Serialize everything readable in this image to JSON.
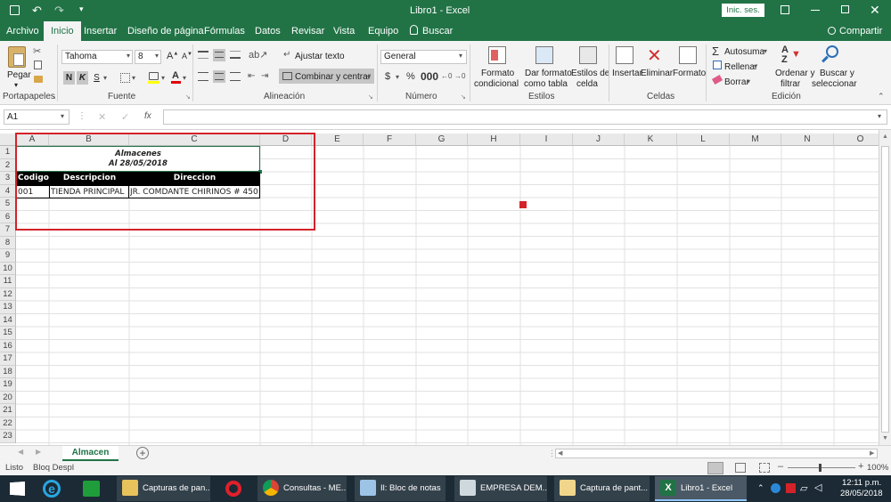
{
  "app": {
    "title": "Libro1 - Excel",
    "signin_label": "Inic. ses.",
    "accent": "#217346"
  },
  "ribbon_tabs": [
    "Archivo",
    "Inicio",
    "Insertar",
    "Diseño de página",
    "Fórmulas",
    "Datos",
    "Revisar",
    "Vista",
    "Equipo"
  ],
  "search_label": "Buscar",
  "share_label": "Compartir",
  "ribbon": {
    "paste_label": "Pegar",
    "font_name": "Tahoma",
    "font_size": "8",
    "bold": "N",
    "italic": "K",
    "underline": "S",
    "wrap_text": "Ajustar texto",
    "merge_center": "Combinar y centrar",
    "number_format": "General",
    "cond_format_1": "Formato",
    "cond_format_2": "condicional",
    "format_table_1": "Dar formato",
    "format_table_2": "como tabla",
    "cell_styles_1": "Estilos de",
    "cell_styles_2": "celda",
    "insert": "Insertar",
    "delete": "Eliminar",
    "format": "Formato",
    "autosum": "Autosuma",
    "fill": "Rellenar",
    "clear": "Borrar",
    "sort_1": "Ordenar y",
    "sort_2": "filtrar",
    "find_1": "Buscar y",
    "find_2": "seleccionar",
    "groups": {
      "clipboard": "Portapapeles",
      "font": "Fuente",
      "alignment": "Alineación",
      "number": "Número",
      "styles": "Estilos",
      "cells": "Celdas",
      "editing": "Edición"
    }
  },
  "formula_bar": {
    "name_box": "A1",
    "fx": "fx",
    "value": ""
  },
  "columns": [
    "A",
    "B",
    "C",
    "D",
    "E",
    "F",
    "G",
    "H",
    "I",
    "J",
    "K",
    "L",
    "M",
    "N",
    "O"
  ],
  "rows": [
    "1",
    "2",
    "3",
    "4",
    "5",
    "6",
    "7",
    "8",
    "9",
    "10",
    "11",
    "12",
    "13",
    "14",
    "15",
    "16",
    "17",
    "18",
    "19",
    "20",
    "21",
    "22",
    "23"
  ],
  "sheet": {
    "title_1": "Almacenes",
    "title_2": "Al 28/05/2018",
    "headers": [
      "Codigo",
      "Descripcion",
      "Direccion"
    ],
    "row": [
      "001",
      "TIENDA PRINCIPAL",
      "JR. COMDANTE CHIRINOS # 450"
    ]
  },
  "sheet_tabs": [
    "Almacen"
  ],
  "status": {
    "ready": "Listo",
    "scroll_lock": "Bloq Despl",
    "zoom": "100%"
  },
  "taskbar": {
    "items": [
      "Capturas de pan...",
      "Consultas - ME...",
      "Il: Bloc de notas",
      "EMPRESA DEM...",
      "Captura de pant...",
      "Libro1 - Excel"
    ],
    "time": "12:11 p.m.",
    "date": "28/05/2018"
  }
}
